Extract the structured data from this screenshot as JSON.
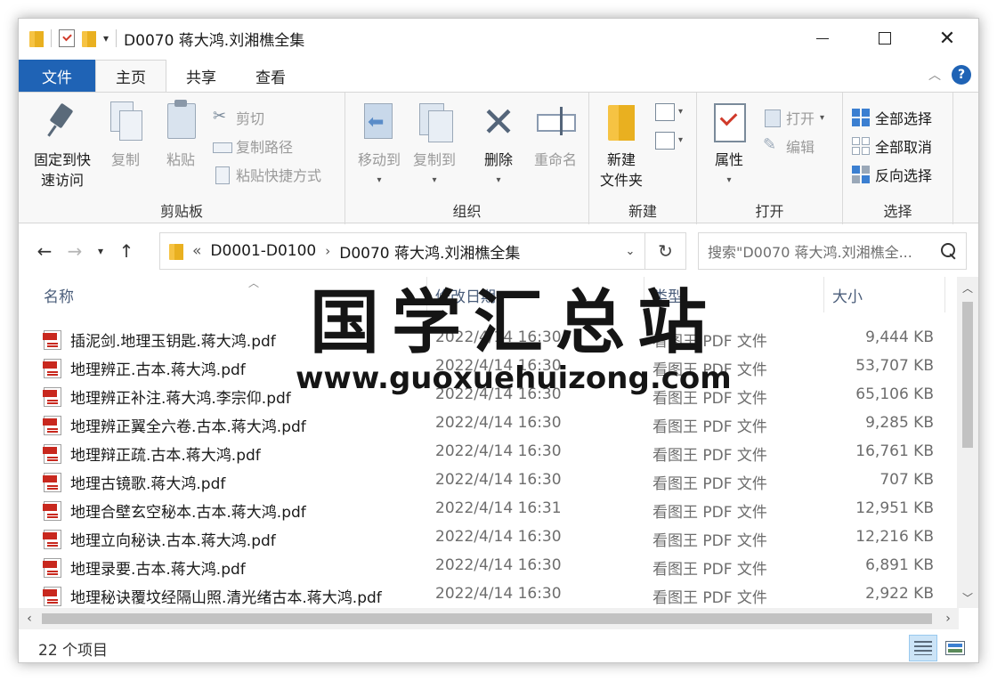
{
  "window": {
    "title": "D0070 蒋大鸿.刘湘樵全集"
  },
  "tabs": [
    {
      "label": "文件"
    },
    {
      "label": "主页"
    },
    {
      "label": "共享"
    },
    {
      "label": "查看"
    }
  ],
  "ribbon": {
    "clipboard": {
      "pin": "固定到快\n速访问",
      "copy": "复制",
      "paste": "粘贴",
      "cut": "剪切",
      "copy_path": "复制路径",
      "paste_shortcut": "粘贴快捷方式",
      "label": "剪贴板"
    },
    "organize": {
      "move_to": "移动到",
      "copy_to": "复制到",
      "delete": "删除",
      "rename": "重命名",
      "label": "组织"
    },
    "new": {
      "new_folder": "新建\n文件夹",
      "label": "新建"
    },
    "open": {
      "properties": "属性",
      "open": "打开",
      "edit": "编辑",
      "label": "打开"
    },
    "select": {
      "select_all": "全部选择",
      "select_none": "全部取消",
      "invert": "反向选择",
      "label": "选择"
    }
  },
  "address": {
    "overflow": "«",
    "crumbs": [
      "D0001-D0100",
      "D0070 蒋大鸿.刘湘樵全集"
    ]
  },
  "search": {
    "placeholder": "搜索\"D0070 蒋大鸿.刘湘樵全..."
  },
  "columns": {
    "name": "名称",
    "date": "修改日期",
    "type": "类型",
    "size": "大小"
  },
  "files": [
    {
      "name": "插泥剑.地理玉钥匙.蒋大鸿.pdf",
      "date": "2022/4/14 16:30",
      "type": "看图王 PDF 文件",
      "size": "9,444 KB"
    },
    {
      "name": "地理辨正.古本.蒋大鸿.pdf",
      "date": "2022/4/14 16:30",
      "type": "看图王 PDF 文件",
      "size": "53,707 KB"
    },
    {
      "name": "地理辨正补注.蒋大鸿.李宗仰.pdf",
      "date": "2022/4/14 16:30",
      "type": "看图王 PDF 文件",
      "size": "65,106 KB"
    },
    {
      "name": "地理辨正翼全六卷.古本.蒋大鸿.pdf",
      "date": "2022/4/14 16:30",
      "type": "看图王 PDF 文件",
      "size": "9,285 KB"
    },
    {
      "name": "地理辩正疏.古本.蒋大鸿.pdf",
      "date": "2022/4/14 16:30",
      "type": "看图王 PDF 文件",
      "size": "16,761 KB"
    },
    {
      "name": "地理古镜歌.蒋大鸿.pdf",
      "date": "2022/4/14 16:30",
      "type": "看图王 PDF 文件",
      "size": "707 KB"
    },
    {
      "name": "地理合壁玄空秘本.古本.蒋大鸿.pdf",
      "date": "2022/4/14 16:31",
      "type": "看图王 PDF 文件",
      "size": "12,951 KB"
    },
    {
      "name": "地理立向秘诀.古本.蒋大鸿.pdf",
      "date": "2022/4/14 16:30",
      "type": "看图王 PDF 文件",
      "size": "12,216 KB"
    },
    {
      "name": "地理录要.古本.蒋大鸿.pdf",
      "date": "2022/4/14 16:30",
      "type": "看图王 PDF 文件",
      "size": "6,891 KB"
    },
    {
      "name": "地理秘诀覆坟经隔山照.清光绪古本.蒋大鸿.pdf",
      "date": "2022/4/14 16:30",
      "type": "看图王 PDF 文件",
      "size": "2,922 KB"
    }
  ],
  "status": {
    "count": "22 个项目"
  },
  "watermark": {
    "title": "国学汇总站",
    "url": "www.guoxuehuizong.com"
  },
  "colors": {
    "accent": "#1f63b5",
    "header_text": "#4a5d7a"
  }
}
